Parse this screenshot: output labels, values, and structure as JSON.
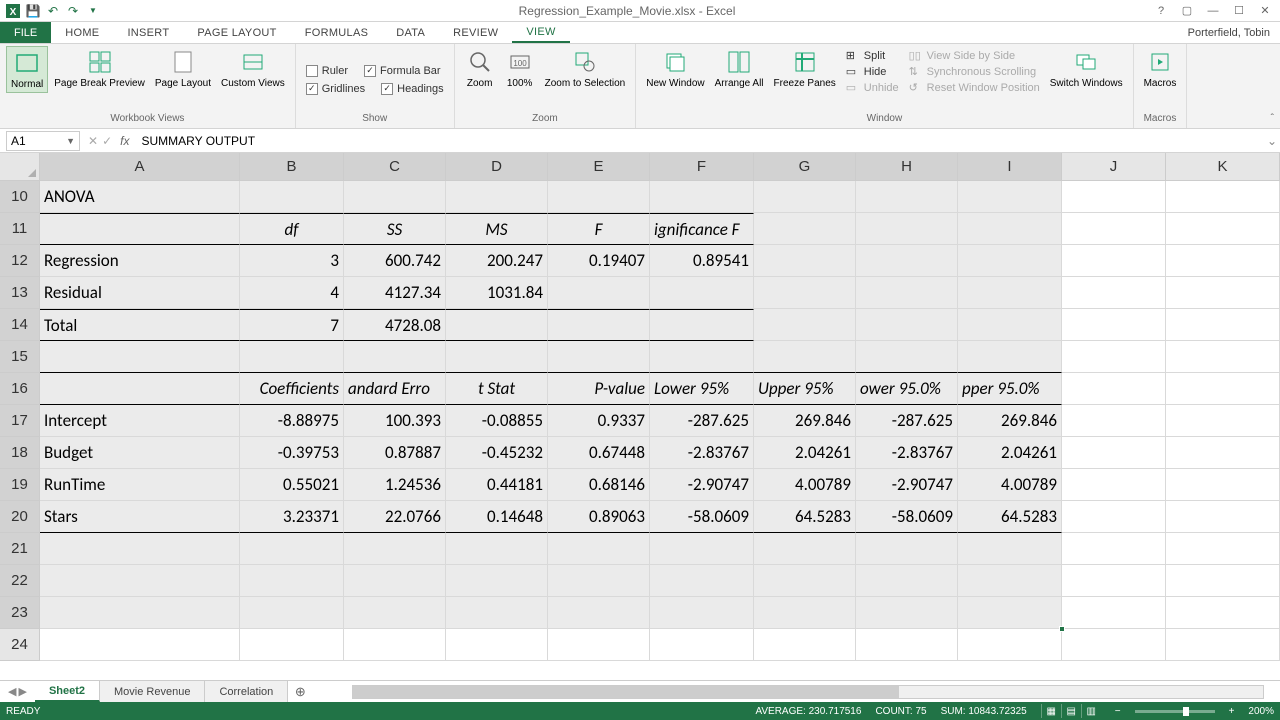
{
  "app": {
    "title": "Regression_Example_Movie.xlsx - Excel",
    "user": "Porterfield, Tobin"
  },
  "tabs": {
    "file": "FILE",
    "list": [
      "HOME",
      "INSERT",
      "PAGE LAYOUT",
      "FORMULAS",
      "DATA",
      "REVIEW",
      "VIEW"
    ],
    "active": "VIEW"
  },
  "ribbon": {
    "views": {
      "normal": "Normal",
      "pagebreak": "Page Break Preview",
      "pagelayout": "Page Layout",
      "custom": "Custom Views",
      "group": "Workbook Views"
    },
    "show": {
      "ruler": "Ruler",
      "formulabar": "Formula Bar",
      "gridlines": "Gridlines",
      "headings": "Headings",
      "group": "Show"
    },
    "zoom": {
      "zoom": "Zoom",
      "hundred": "100%",
      "sel": "Zoom to Selection",
      "group": "Zoom"
    },
    "window": {
      "new": "New Window",
      "arrange": "Arrange All",
      "freeze": "Freeze Panes",
      "split": "Split",
      "hide": "Hide",
      "unhide": "Unhide",
      "sbs": "View Side by Side",
      "sync": "Synchronous Scrolling",
      "reset": "Reset Window Position",
      "switch": "Switch Windows",
      "group": "Window"
    },
    "macros": {
      "macros": "Macros",
      "group": "Macros"
    }
  },
  "fbar": {
    "cell": "A1",
    "formula": "SUMMARY OUTPUT"
  },
  "columns": [
    "A",
    "B",
    "C",
    "D",
    "E",
    "F",
    "G",
    "H",
    "I",
    "J",
    "K"
  ],
  "rows": [
    "10",
    "11",
    "12",
    "13",
    "14",
    "15",
    "16",
    "17",
    "18",
    "19",
    "20",
    "21",
    "22",
    "23",
    "24"
  ],
  "cells": {
    "r10": {
      "A": "ANOVA"
    },
    "r11": {
      "B": "df",
      "C": "SS",
      "D": "MS",
      "E": "F",
      "F": "ignificance F"
    },
    "r12": {
      "A": "Regression",
      "B": "3",
      "C": "600.742",
      "D": "200.247",
      "E": "0.19407",
      "F": "0.89541"
    },
    "r13": {
      "A": "Residual",
      "B": "4",
      "C": "4127.34",
      "D": "1031.84"
    },
    "r14": {
      "A": "Total",
      "B": "7",
      "C": "4728.08"
    },
    "r16": {
      "B": "Coefficients",
      "C": "andard Erro",
      "D": "t Stat",
      "E": "P-value",
      "F": "Lower 95%",
      "G": "Upper 95%",
      "H": "ower 95.0%",
      "I": "pper 95.0%"
    },
    "r17": {
      "A": "Intercept",
      "B": "-8.88975",
      "C": "100.393",
      "D": "-0.08855",
      "E": "0.9337",
      "F": "-287.625",
      "G": "269.846",
      "H": "-287.625",
      "I": "269.846"
    },
    "r18": {
      "A": "Budget",
      "B": "-0.39753",
      "C": "0.87887",
      "D": "-0.45232",
      "E": "0.67448",
      "F": "-2.83767",
      "G": "2.04261",
      "H": "-2.83767",
      "I": "2.04261"
    },
    "r19": {
      "A": "RunTime",
      "B": "0.55021",
      "C": "1.24536",
      "D": "0.44181",
      "E": "0.68146",
      "F": "-2.90747",
      "G": "4.00789",
      "H": "-2.90747",
      "I": "4.00789"
    },
    "r20": {
      "A": "Stars",
      "B": "3.23371",
      "C": "22.0766",
      "D": "0.14648",
      "E": "0.89063",
      "F": "-58.0609",
      "G": "64.5283",
      "H": "-58.0609",
      "I": "64.5283"
    }
  },
  "sheets": {
    "list": [
      "Sheet2",
      "Movie Revenue",
      "Correlation"
    ],
    "active": "Sheet2"
  },
  "status": {
    "ready": "READY",
    "avg": "AVERAGE: 230.717516",
    "count": "COUNT: 75",
    "sum": "SUM: 10843.72325",
    "zoom": "200%"
  }
}
